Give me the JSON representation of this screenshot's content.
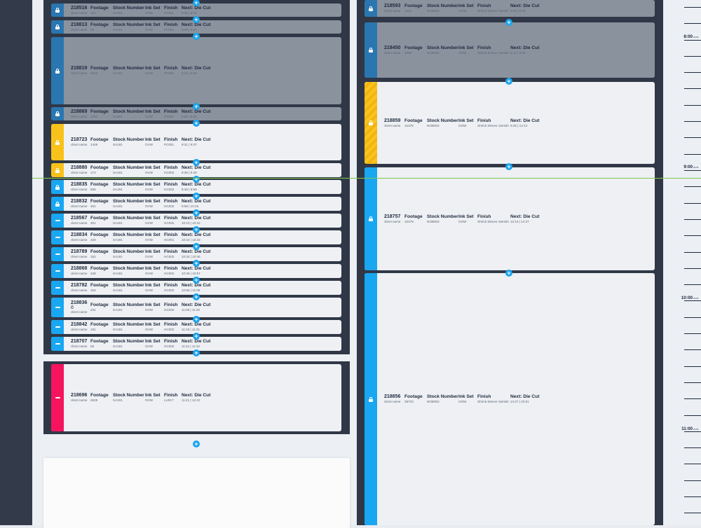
{
  "labels": {
    "footage": "Footage",
    "stock_number": "Stock Number",
    "ink_set": "Ink Set",
    "finish": "Finish",
    "next": "Next: Die Cut",
    "client": "client name"
  },
  "colors": {
    "blue_dark": "#2a76b0",
    "blue": "#19a7f2",
    "yellow": "#f9c21a",
    "pink": "#f5145d",
    "locked_gray": "#8a929e",
    "card": "#eef0f3",
    "frame": "#303847",
    "now_line": "#7ec84a"
  },
  "left_column": {
    "jobs": [
      {
        "id": "218516",
        "footage": "161",
        "stock": "SA191",
        "ink": "OVW",
        "finish": "PC001",
        "time": "8:32 | 8:34",
        "state": "locked-gray",
        "icon": "lock-icon"
      },
      {
        "id": "218813",
        "footage": "96",
        "stock": "SA191",
        "ink": "OVW",
        "finish": "PC001",
        "time": "8:35 | 8:37",
        "state": "locked-gray",
        "icon": "lock-icon"
      },
      {
        "id": "218819",
        "footage": "2610",
        "stock": "SA191",
        "ink": "OVW",
        "finish": "PC001",
        "time": "8:44 | 8:53",
        "state": "locked-gray",
        "icon": "lock-icon"
      },
      {
        "id": "218869",
        "footage": "1307",
        "stock": "SA191",
        "ink": "OVW",
        "finish": "PC001",
        "time": "9:05 | 9:20",
        "state": "locked-gray",
        "icon": "lock-icon"
      },
      {
        "id": "218723",
        "footage": "1448",
        "stock": "SA191",
        "ink": "OVW",
        "finish": "PC001",
        "time": "9:21 | 9:37",
        "state": "yellow",
        "icon": "lock-icon"
      },
      {
        "id": "218880",
        "footage": "172",
        "stock": "SA191",
        "ink": "OVW",
        "finish": "HC002",
        "time": "9:36 | 9:48",
        "state": "yellow",
        "icon": "lock-icon"
      },
      {
        "id": "218835",
        "footage": "568",
        "stock": "SA191",
        "ink": "OVW",
        "finish": "HC002",
        "time": "9:48 | 9:59",
        "state": "blue",
        "icon": "lock-icon"
      },
      {
        "id": "218832",
        "footage": "461",
        "stock": "SA191",
        "ink": "OVW",
        "finish": "HC002",
        "time": "9:58 | 10:15",
        "state": "blue",
        "icon": "lock-icon"
      },
      {
        "id": "218567",
        "footage": "301",
        "stock": "SA191",
        "ink": "OVW",
        "finish": "HC002",
        "time": "10:10 | 10:22",
        "state": "blue",
        "icon": "drag-handle-icon"
      },
      {
        "id": "218834",
        "footage": "428",
        "stock": "SA191",
        "ink": "OVW",
        "finish": "HC001",
        "time": "10:22 | 10:33",
        "state": "blue",
        "icon": "drag-handle-icon"
      },
      {
        "id": "218789",
        "footage": "152",
        "stock": "SA191",
        "ink": "OVW",
        "finish": "HC002",
        "time": "10:34 | 10:46",
        "state": "blue",
        "icon": "drag-handle-icon"
      },
      {
        "id": "218868",
        "footage": "248",
        "stock": "SA191",
        "ink": "OVW",
        "finish": "HC002",
        "time": "10:45 | 10:57",
        "state": "blue",
        "icon": "drag-handle-icon"
      },
      {
        "id": "218782",
        "footage": "164",
        "stock": "SA191",
        "ink": "OVW",
        "finish": "HC002",
        "time": "10:56 | 11:08",
        "state": "blue",
        "icon": "drag-handle-icon"
      },
      {
        "id": "218836",
        "footage": "231",
        "stock": "SA191",
        "ink": "OVW",
        "finish": "HC002",
        "time": "11:08 | 11:20",
        "state": "blue",
        "icon": "drag-handle-icon",
        "extra": "ô"
      },
      {
        "id": "218842",
        "footage": "191",
        "stock": "SA191",
        "ink": "OVW",
        "finish": "HC002",
        "time": "11:19 | 11:31",
        "state": "blue",
        "icon": "drag-handle-icon"
      },
      {
        "id": "218707",
        "footage": "68",
        "stock": "SA191",
        "ink": "OVW",
        "finish": "HC002",
        "time": "11:31 | 11:42",
        "state": "blue",
        "icon": "drag-handle-icon"
      }
    ],
    "unscheduled": {
      "id": "218696",
      "footage": "2629",
      "stock": "SA191",
      "ink": "OVW",
      "finish": "LU017",
      "time": "11:41 | 12:10",
      "state": "pink",
      "icon": "drag-handle-icon"
    }
  },
  "right_column": {
    "jobs": [
      {
        "id": "218593",
        "footage": "1211",
        "stock": "NOB002",
        "ink": "OOW",
        "finish": "Shrink Sleeve Varnish",
        "time": "8:00 | 8:26",
        "state": "locked-gray",
        "icon": "lock-icon"
      },
      {
        "id": "218450",
        "footage": "2598",
        "stock": "NOB002",
        "ink": "OOW",
        "finish": "Shrink Sleeve Varnish",
        "time": "9:12 | 9:40",
        "state": "locked-gray",
        "icon": "lock-icon"
      },
      {
        "id": "218859",
        "footage": "12375",
        "stock": "NOB002",
        "ink": "OOW",
        "finish": "Shrink Sleeve Varnish",
        "time": "9:45 | 12:14",
        "state": "yellow-hatch",
        "icon": "lock-icon"
      },
      {
        "id": "218757",
        "footage": "10476",
        "stock": "NOB002",
        "ink": "OOW",
        "finish": "Shrink Sleeve Varnish",
        "time": "12:16 | 14:27",
        "state": "blue",
        "icon": "lock-icon"
      },
      {
        "id": "218856",
        "footage": "39723",
        "stock": "NOB002",
        "ink": "OOW",
        "finish": "Shrink Sleeve Varnish",
        "time": "14:27 | 23:01",
        "state": "blue",
        "icon": "lock-icon"
      }
    ]
  },
  "timeline": {
    "labels": [
      {
        "time": "8:00",
        "suffix": "a.m."
      },
      {
        "time": "9:00",
        "suffix": "a.m."
      },
      {
        "time": "10:00",
        "suffix": "a.m."
      },
      {
        "time": "11:00",
        "suffix": "a.m."
      }
    ],
    "add_symbol": "+"
  }
}
